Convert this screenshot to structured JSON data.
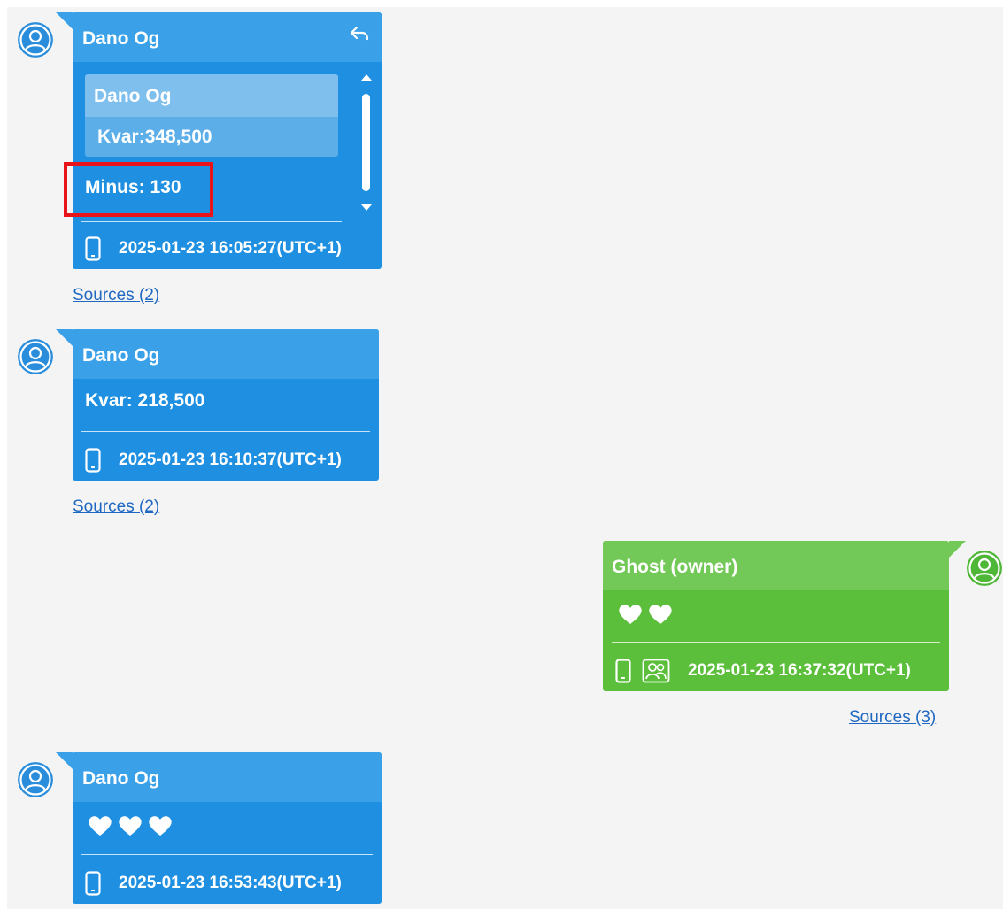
{
  "messages": [
    {
      "sender": "Dano Og",
      "quote": {
        "sender": "Dano Og",
        "text": "Kvar:348,500"
      },
      "text": "Minus: 130",
      "timestamp": "2025-01-23 16:05:27(UTC+1)",
      "sources": "Sources (2)"
    },
    {
      "sender": "Dano Og",
      "text": "Kvar: 218,500",
      "timestamp": "2025-01-23 16:10:37(UTC+1)",
      "sources": "Sources (2)"
    },
    {
      "sender": "Ghost (owner)",
      "text": "❤️❤️",
      "timestamp": "2025-01-23 16:37:32(UTC+1)",
      "sources": "Sources (3)"
    },
    {
      "sender": "Dano Og",
      "text": "❤️❤️❤️",
      "timestamp": "2025-01-23 16:53:43(UTC+1)"
    }
  ],
  "icons": {
    "avatar": "user-avatar-icon",
    "reply": "reply-icon",
    "device": "phone-icon",
    "group": "group-icon",
    "heart": "heart-icon"
  },
  "colors": {
    "incoming_bubble": "#1e8fe1",
    "outgoing_bubble": "#5bbf3b",
    "link": "#1f68c2",
    "highlight": "#e8141a"
  }
}
